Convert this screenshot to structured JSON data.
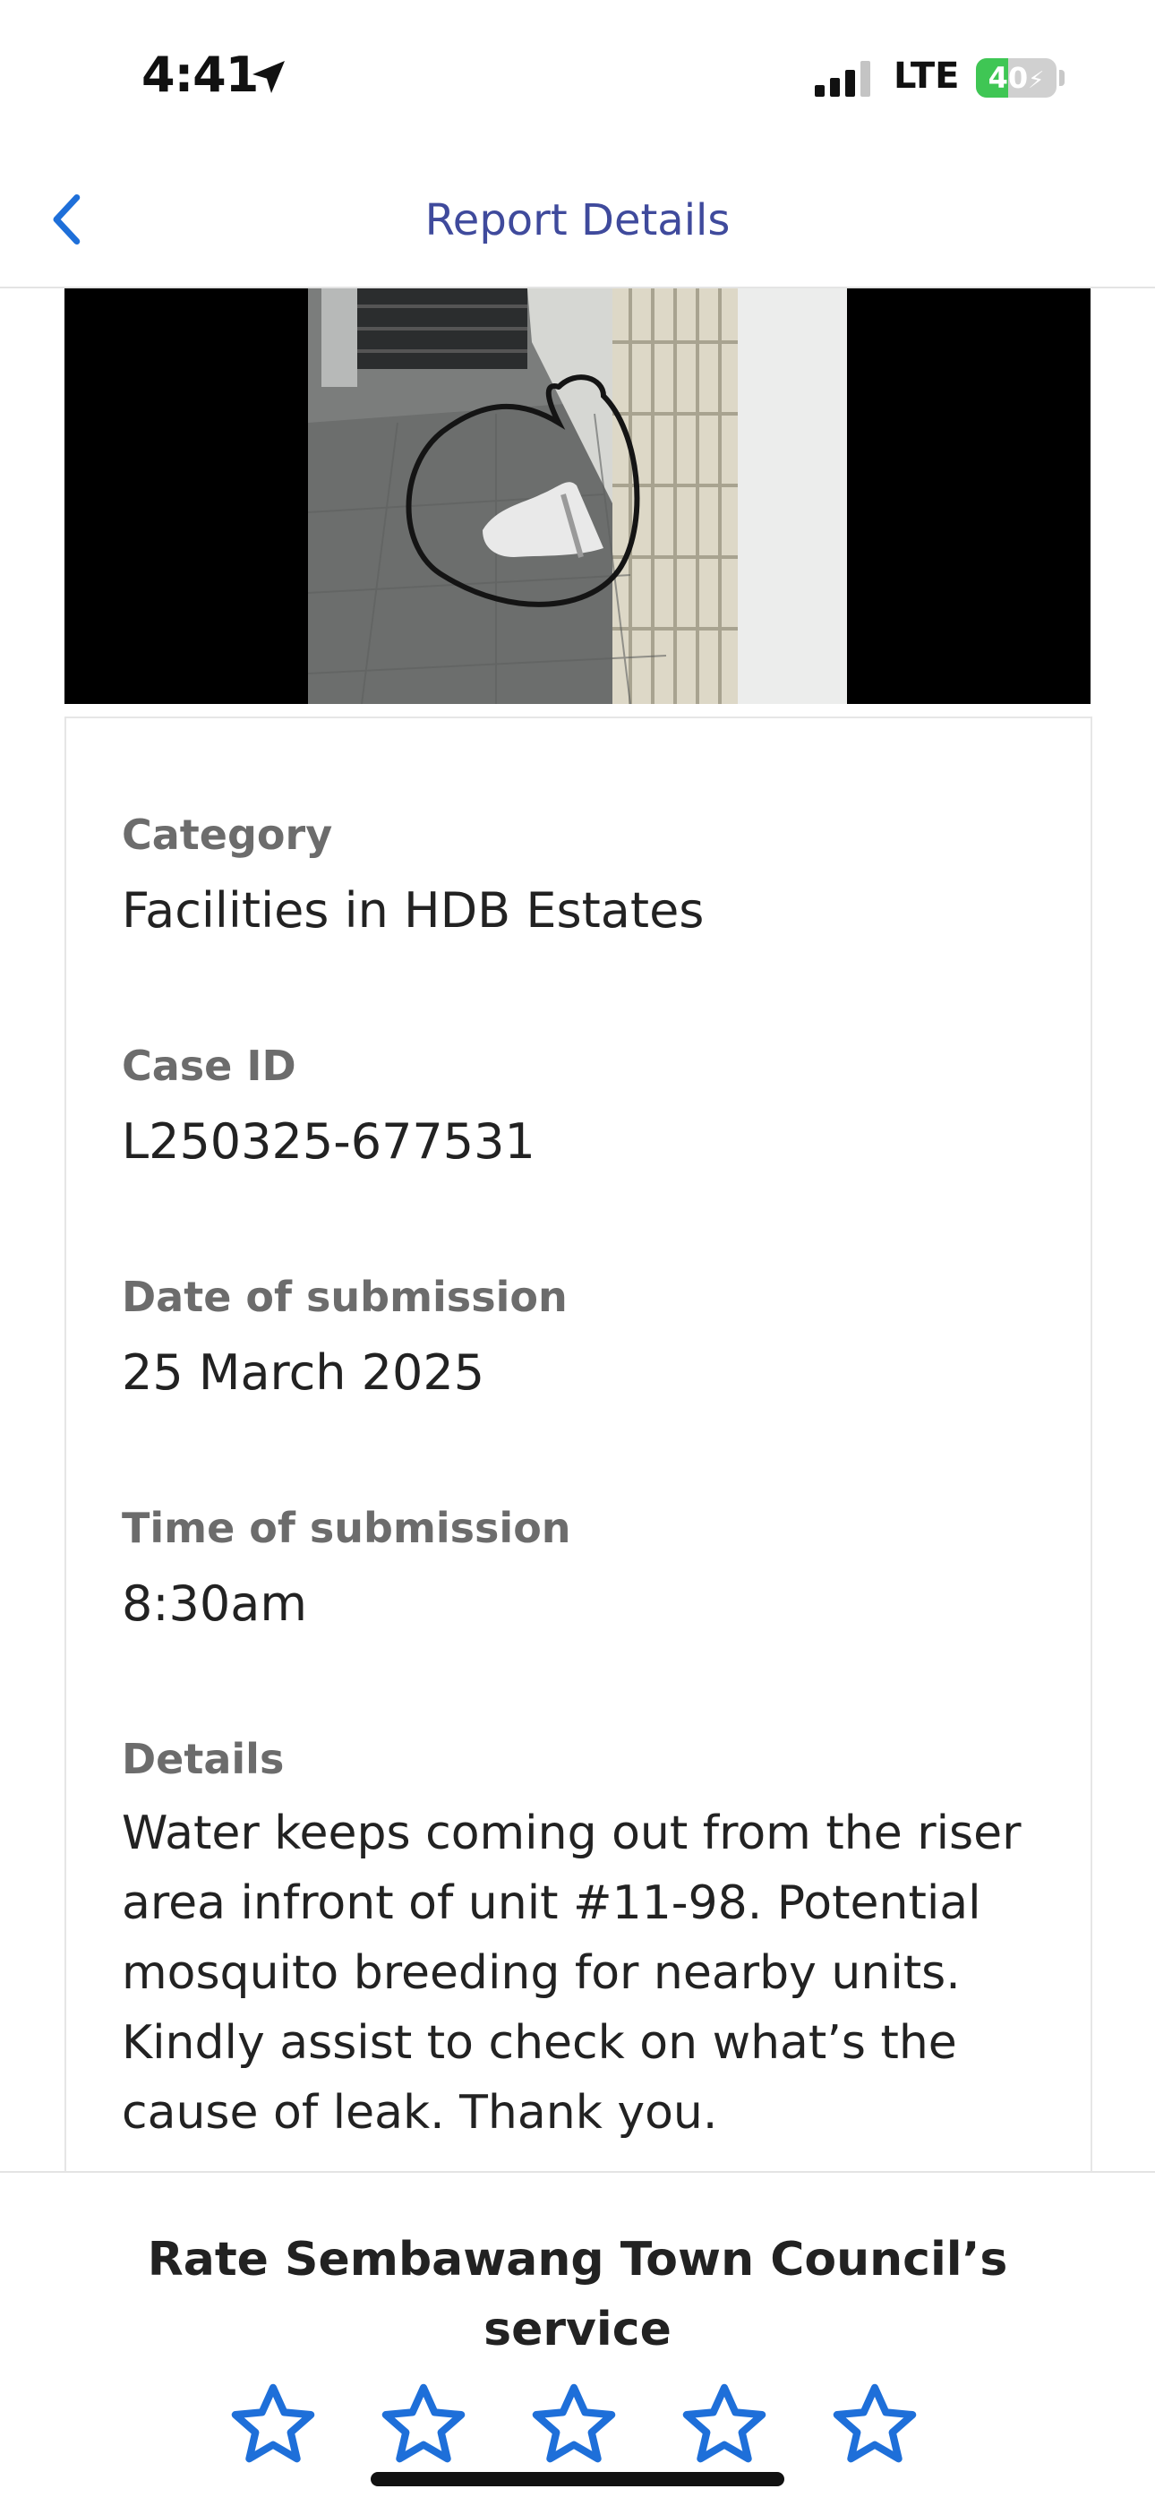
{
  "status_bar": {
    "time": "4:41",
    "network": "LTE",
    "battery_percent": 40,
    "battery_label": "40",
    "battery_charging": true,
    "battery_color": "#3fc654"
  },
  "nav": {
    "title": "Report Details",
    "back_icon": "chevron-left-icon",
    "title_color": "#3f4a9c"
  },
  "report": {
    "photo_icon": "report-photo",
    "fields": [
      {
        "label": "Category",
        "value": "Facilities in HDB Estates"
      },
      {
        "label": "Case ID",
        "value": "L250325-677531"
      },
      {
        "label": "Date of submission",
        "value": "25 March 2025"
      },
      {
        "label": "Time of submission",
        "value": "8:30am"
      },
      {
        "label": "Details",
        "value": "Water keeps coming out from the riser area infront of unit #11-98. Potential mosquito breeding for nearby units. Kindly assist to check on what’s the cause of leak. Thank you."
      }
    ]
  },
  "rating": {
    "title": "Rate Sembawang Town Council’s service",
    "max_stars": 5,
    "selected_stars": 0,
    "star_color": "#1e6fd9"
  }
}
